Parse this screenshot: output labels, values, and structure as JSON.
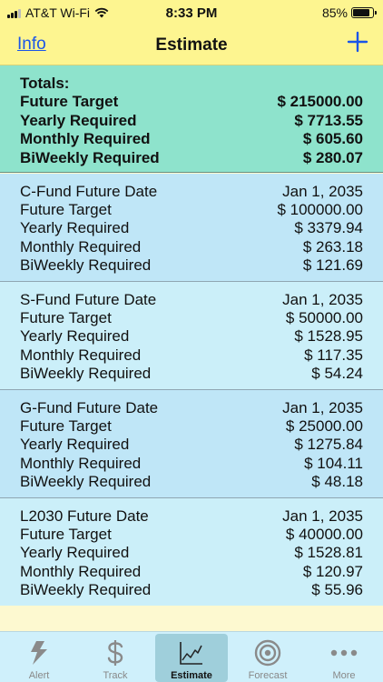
{
  "status_bar": {
    "carrier": "AT&T Wi-Fi",
    "time": "8:33 PM",
    "battery": "85%",
    "battery_level": 0.85
  },
  "nav": {
    "info_label": "Info",
    "title": "Estimate",
    "add_icon": "plus-icon"
  },
  "totals": {
    "heading": "Totals:",
    "rows": [
      {
        "label": "Future Target",
        "value": "$ 215000.00"
      },
      {
        "label": "Yearly Required",
        "value": "$ 7713.55"
      },
      {
        "label": "Monthly Required",
        "value": "$ 605.60"
      },
      {
        "label": "BiWeekly Required",
        "value": "$ 280.07"
      }
    ]
  },
  "funds": [
    {
      "rows": [
        {
          "label": "C-Fund Future Date",
          "value": "Jan 1, 2035"
        },
        {
          "label": "Future Target",
          "value": "$ 100000.00"
        },
        {
          "label": "Yearly Required",
          "value": "$ 3379.94"
        },
        {
          "label": "Monthly Required",
          "value": "$ 263.18"
        },
        {
          "label": "BiWeekly Required",
          "value": "$ 121.69"
        }
      ]
    },
    {
      "rows": [
        {
          "label": "S-Fund Future Date",
          "value": "Jan 1, 2035"
        },
        {
          "label": "Future Target",
          "value": "$ 50000.00"
        },
        {
          "label": "Yearly Required",
          "value": "$ 1528.95"
        },
        {
          "label": "Monthly Required",
          "value": "$ 117.35"
        },
        {
          "label": "BiWeekly Required",
          "value": "$ 54.24"
        }
      ]
    },
    {
      "rows": [
        {
          "label": "G-Fund Future Date",
          "value": "Jan 1, 2035"
        },
        {
          "label": "Future Target",
          "value": "$ 25000.00"
        },
        {
          "label": "Yearly Required",
          "value": "$ 1275.84"
        },
        {
          "label": "Monthly Required",
          "value": "$ 104.11"
        },
        {
          "label": "BiWeekly Required",
          "value": "$ 48.18"
        }
      ]
    },
    {
      "rows": [
        {
          "label": "L2030 Future Date",
          "value": "Jan 1, 2035"
        },
        {
          "label": "Future Target",
          "value": "$ 40000.00"
        },
        {
          "label": "Yearly Required",
          "value": "$ 1528.81"
        },
        {
          "label": "Monthly Required",
          "value": "$ 120.97"
        },
        {
          "label": "BiWeekly Required",
          "value": "$ 55.96"
        }
      ]
    }
  ],
  "fund_colors": [
    "#bfe6f7",
    "#cbeff9",
    "#bfe6f7",
    "#cbeff9"
  ],
  "tabs": [
    {
      "label": "Alert",
      "icon": "lightning-icon",
      "active": false
    },
    {
      "label": "Track",
      "icon": "dollar-icon",
      "active": false
    },
    {
      "label": "Estimate",
      "icon": "chart-icon",
      "active": true
    },
    {
      "label": "Forecast",
      "icon": "target-icon",
      "active": false
    },
    {
      "label": "More",
      "icon": "more-icon",
      "active": false
    }
  ]
}
